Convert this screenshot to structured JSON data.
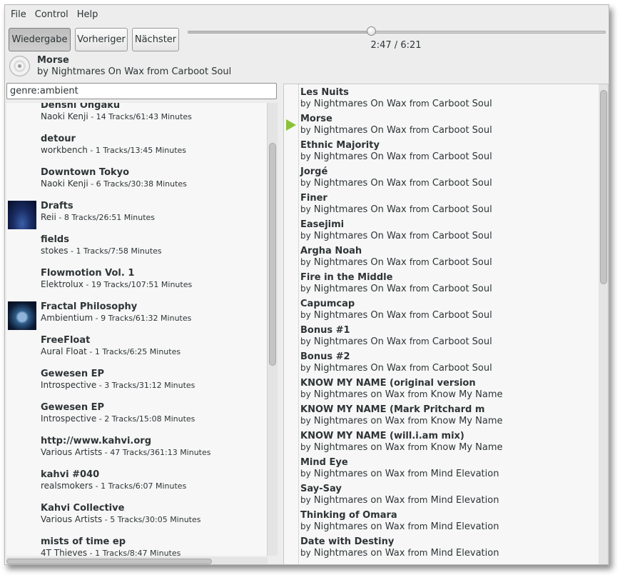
{
  "menu": {
    "file": "File",
    "control": "Control",
    "help": "Help"
  },
  "toolbar": {
    "play_label": "Wiedergabe",
    "prev_label": "Vorheriger",
    "next_label": "Nächster",
    "time": "2:47 / 6:21",
    "progress": 0.438
  },
  "now_playing": {
    "title": "Morse",
    "by_word": "by",
    "artist": "Nightmares On Wax",
    "from_word": "from",
    "album": "Carboot Soul"
  },
  "search": {
    "value": "genre:ambient"
  },
  "albums": [
    {
      "title": "Denshi Ongaku",
      "artist": "Naoki Kenji",
      "stats": "14 Tracks/61:43 Minutes"
    },
    {
      "title": "detour",
      "artist": "workbench",
      "stats": "1 Tracks/13:45 Minutes"
    },
    {
      "title": "Downtown Tokyo",
      "artist": "Naoki Kenji",
      "stats": "6 Tracks/30:38 Minutes"
    },
    {
      "title": "Drafts",
      "artist": "Reii",
      "stats": "8 Tracks/26:51 Minutes",
      "cover": "drafts"
    },
    {
      "title": "fields",
      "artist": "stokes",
      "stats": "1 Tracks/7:58 Minutes"
    },
    {
      "title": "Flowmotion Vol. 1",
      "artist": "Elektrolux",
      "stats": "19 Tracks/107:51 Minutes"
    },
    {
      "title": "Fractal Philosophy",
      "artist": "Ambientium",
      "stats": "9 Tracks/61:32 Minutes",
      "cover": "fractal"
    },
    {
      "title": "FreeFloat",
      "artist": "Aural Float",
      "stats": "1 Tracks/6:25 Minutes"
    },
    {
      "title": "Gewesen EP",
      "artist": "Introspective",
      "stats": "3 Tracks/31:12 Minutes"
    },
    {
      "title": "Gewesen EP",
      "artist": "Introspective",
      "stats": "2 Tracks/15:08 Minutes"
    },
    {
      "title": "http://www.kahvi.org",
      "artist": "Various Artists",
      "stats": "47 Tracks/361:13 Minutes"
    },
    {
      "title": "kahvi #040",
      "artist": "realsmokers",
      "stats": "1 Tracks/6:07 Minutes"
    },
    {
      "title": "Kahvi Collective",
      "artist": "Various Artists",
      "stats": "5 Tracks/30:05 Minutes"
    },
    {
      "title": "mists of time ep",
      "artist": "4T Thieves",
      "stats": "1 Tracks/8:47 Minutes"
    }
  ],
  "tracks": [
    {
      "title": "Les Nuits",
      "artist": "Nightmares On Wax",
      "album": "Carboot Soul"
    },
    {
      "title": "Morse",
      "artist": "Nightmares On Wax",
      "album": "Carboot Soul",
      "playing": true
    },
    {
      "title": "Ethnic Majority",
      "artist": "Nightmares On Wax",
      "album": "Carboot Soul"
    },
    {
      "title": "Jorgé",
      "artist": "Nightmares On Wax",
      "album": "Carboot Soul"
    },
    {
      "title": "Finer",
      "artist": "Nightmares On Wax",
      "album": "Carboot Soul"
    },
    {
      "title": "Easejimi",
      "artist": "Nightmares On Wax",
      "album": "Carboot Soul"
    },
    {
      "title": "Argha Noah",
      "artist": "Nightmares On Wax",
      "album": "Carboot Soul"
    },
    {
      "title": "Fire in the Middle",
      "artist": "Nightmares On Wax",
      "album": "Carboot Soul"
    },
    {
      "title": "Capumcap",
      "artist": "Nightmares On Wax",
      "album": "Carboot Soul"
    },
    {
      "title": "Bonus #1",
      "artist": "Nightmares On Wax",
      "album": "Carboot Soul"
    },
    {
      "title": "Bonus #2",
      "artist": "Nightmares On Wax",
      "album": "Carboot Soul"
    },
    {
      "title": "KNOW MY NAME (original version",
      "artist": "Nightmares on Wax",
      "album": "Know My Name"
    },
    {
      "title": "KNOW MY NAME (Mark Pritchard m",
      "artist": "Nightmares on Wax",
      "album": "Know My Name"
    },
    {
      "title": "KNOW MY NAME (will.i.am mix)",
      "artist": "Nightmares on Wax",
      "album": "Know My Name"
    },
    {
      "title": "Mind Eye",
      "artist": "Nightmares on Wax",
      "album": "Mind Elevation"
    },
    {
      "title": "Say-Say",
      "artist": "Nightmares on Wax",
      "album": "Mind Elevation"
    },
    {
      "title": "Thinking of Omara",
      "artist": "Nightmares on Wax",
      "album": "Mind Elevation"
    },
    {
      "title": "Date with Destiny",
      "artist": "Nightmares on Wax",
      "album": "Mind Elevation"
    }
  ],
  "labels": {
    "by": "by",
    "from": "from",
    "separator": " - "
  },
  "colors": {
    "play_indicator": "#8ac13a",
    "window_bg": "#ededed",
    "list_bg": "#f7f7f7"
  }
}
